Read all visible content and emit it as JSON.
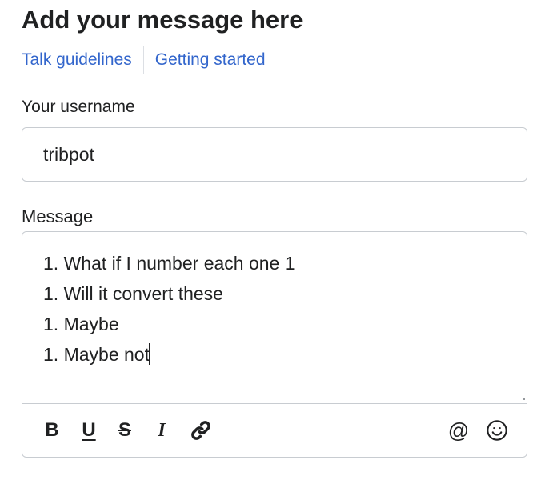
{
  "header": {
    "title": "Add your message here",
    "links": [
      {
        "label": "Talk guidelines"
      },
      {
        "label": "Getting started"
      }
    ]
  },
  "form": {
    "username_label": "Your username",
    "username_value": "tribpot",
    "message_label": "Message",
    "message_lines": [
      "1. What if I number each one 1",
      "1. Will it convert these",
      "1. Maybe",
      "1. Maybe not"
    ]
  },
  "toolbar": {
    "bold_label": "B",
    "underline_label": "U",
    "strike_label": "S",
    "italic_label": "I",
    "mention_label": "@",
    "icons": [
      "bold-icon",
      "underline-icon",
      "strikethrough-icon",
      "italic-icon",
      "link-icon",
      "mention-icon",
      "emoji-icon"
    ]
  },
  "colors": {
    "link": "#3366cc",
    "text": "#202122",
    "border": "#c8ccd1"
  }
}
